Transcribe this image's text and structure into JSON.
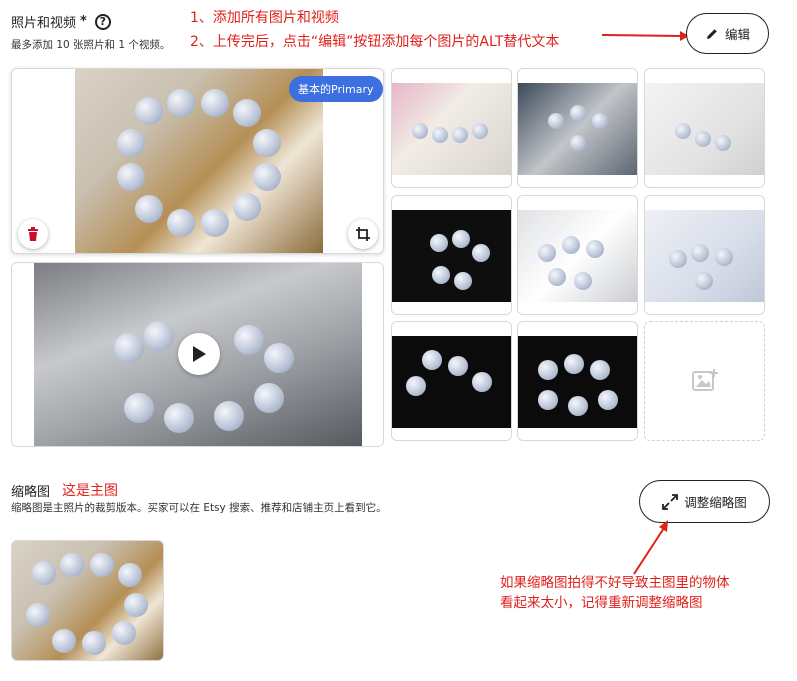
{
  "header": {
    "title": "照片和视频",
    "required_mark": "*",
    "help_icon": "?",
    "subtitle": "最多添加 10 张照片和 1 个视频。",
    "edit_button_label": "编辑"
  },
  "annotations": {
    "step1": "1、添加所有图片和视频",
    "step2": "2、上传完后，点击“编辑”按钮添加每个图片的ALT替代文本",
    "thumbnail_note": "这是主图",
    "resize_note_line1": "如果缩略图拍得不好导致主图里的物体",
    "resize_note_line2": "看起来太小，记得重新调整缩略图"
  },
  "primary": {
    "badge": "基本的Primary"
  },
  "thumbnail_section": {
    "title": "缩略图",
    "subtitle": "缩略图是主照片的裁剪版本。买家可以在 Etsy 搜索、推荐和店铺主页上看到它。",
    "resize_button_label": "调整缩略图"
  },
  "colors": {
    "accent_red": "#e0201b",
    "badge_blue": "#3d6fe0",
    "delete_red": "#c8102e"
  }
}
